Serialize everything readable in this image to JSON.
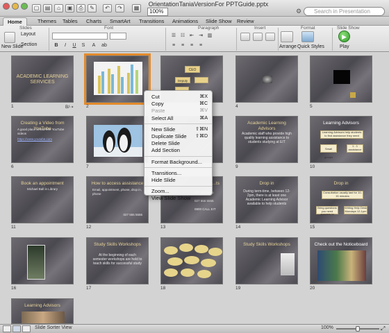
{
  "window": {
    "title": "OrientationTaniaVersionFor PPTGuide.pptx",
    "zoom": "100%",
    "search_placeholder": "Search in Presentation"
  },
  "ribbon": {
    "tabs": [
      "Home",
      "Themes",
      "Tables",
      "Charts",
      "SmartArt",
      "Transitions",
      "Animations",
      "Slide Show",
      "Review"
    ],
    "active_tab": "Home",
    "groups": [
      "Slides",
      "Font",
      "Paragraph",
      "Insert",
      "Format",
      "Slide Show"
    ],
    "new_slide": "New Slide",
    "layout": "Layout",
    "section": "Section",
    "arrange": "Arrange",
    "quick_styles": "Quick Styles",
    "play": "Play"
  },
  "slides": [
    {
      "n": "1",
      "title": "ACADEMIC LEARNING SERVICES"
    },
    {
      "n": "2",
      "title": ""
    },
    {
      "n": "3",
      "title": ""
    },
    {
      "n": "4",
      "title": ""
    },
    {
      "n": "5",
      "title": ""
    },
    {
      "n": "6",
      "title": "Creating a Video from YouTube"
    },
    {
      "n": "7",
      "title": ""
    },
    {
      "n": "8",
      "title": ""
    },
    {
      "n": "9",
      "title": "Academic Learning Advisors"
    },
    {
      "n": "10",
      "title": "Learning Advisors"
    },
    {
      "n": "11",
      "title": "Book an appointment"
    },
    {
      "n": "12",
      "title": "How to access assistance"
    },
    {
      "n": "13",
      "title": "...ts"
    },
    {
      "n": "14",
      "title": "Drop in"
    },
    {
      "n": "15",
      "title": "Drop in"
    },
    {
      "n": "16",
      "title": ""
    },
    {
      "n": "17",
      "title": "Study Skills Workshops"
    },
    {
      "n": "18",
      "title": ""
    },
    {
      "n": "19",
      "title": "Study Skills Workshops"
    },
    {
      "n": "20",
      "title": "Check out the Noticeboard"
    },
    {
      "n": "21",
      "title": "Learning Advisors"
    }
  ],
  "slide_text": {
    "s3_box1": "CEO",
    "s3_box2": "Deputy",
    "s9_body": "Academic staff who provide high quality learning assistance to students studying at EIT",
    "s10_box1": "Learning Advisors help students to find assistance they need",
    "s10_box2": "Small groups",
    "s10_box3": "1 - 1 assistance",
    "s13_num1": "027 555 5555",
    "s13_num2": "027 555 5555",
    "s13_num3": "0800 CALL EIT",
    "s14_body": "During term-time, between 12-2pm, there is at least one Academic Learning Advisor available to help students",
    "s15_box1": "Consultation usually last for 10-15 minutes",
    "s15_box2": "Bring questions you need answers to",
    "s15_box3": "Writing Help Desk Mondays 12-1pm",
    "s17_body": "At the beginning of each semester workshops are held to teach skills for successful study",
    "s6_body": "A good place to find free YouTube videos",
    "s6_link": "https://www.youtube.com",
    "s11_body": "Michael Ball in Library",
    "s12_body": "Email, appointment, phone, drop in, phone",
    "s12_phone": "027 555 5555"
  },
  "context_menu": {
    "items": [
      {
        "label": "Cut",
        "shortcut": "⌘X",
        "enabled": true
      },
      {
        "label": "Copy",
        "shortcut": "⌘C",
        "enabled": true
      },
      {
        "label": "Paste",
        "shortcut": "⌘V",
        "enabled": false
      },
      {
        "label": "Select All",
        "shortcut": "⌘A",
        "enabled": true
      },
      {
        "sep": true
      },
      {
        "label": "New Slide",
        "shortcut": "⇧⌘N",
        "enabled": true
      },
      {
        "label": "Duplicate Slide",
        "shortcut": "⇧⌘D",
        "enabled": true
      },
      {
        "label": "Delete Slide",
        "shortcut": "",
        "enabled": true
      },
      {
        "label": "Add Section",
        "shortcut": "",
        "enabled": true
      },
      {
        "sep": true
      },
      {
        "label": "Format Background...",
        "shortcut": "",
        "enabled": true
      },
      {
        "sep": true
      },
      {
        "label": "Transitions...",
        "shortcut": "",
        "enabled": true
      },
      {
        "label": "Hide Slide",
        "shortcut": "",
        "enabled": true
      },
      {
        "sep": true
      },
      {
        "label": "Zoom...",
        "shortcut": "",
        "enabled": true
      },
      {
        "label": "View Slide Show",
        "shortcut": "",
        "enabled": true
      }
    ]
  },
  "statusbar": {
    "view": "Slide Sorter View",
    "zoom": "100%"
  },
  "colors": {
    "selection": "#e38a2c",
    "slide_title": "#e7d39a"
  }
}
